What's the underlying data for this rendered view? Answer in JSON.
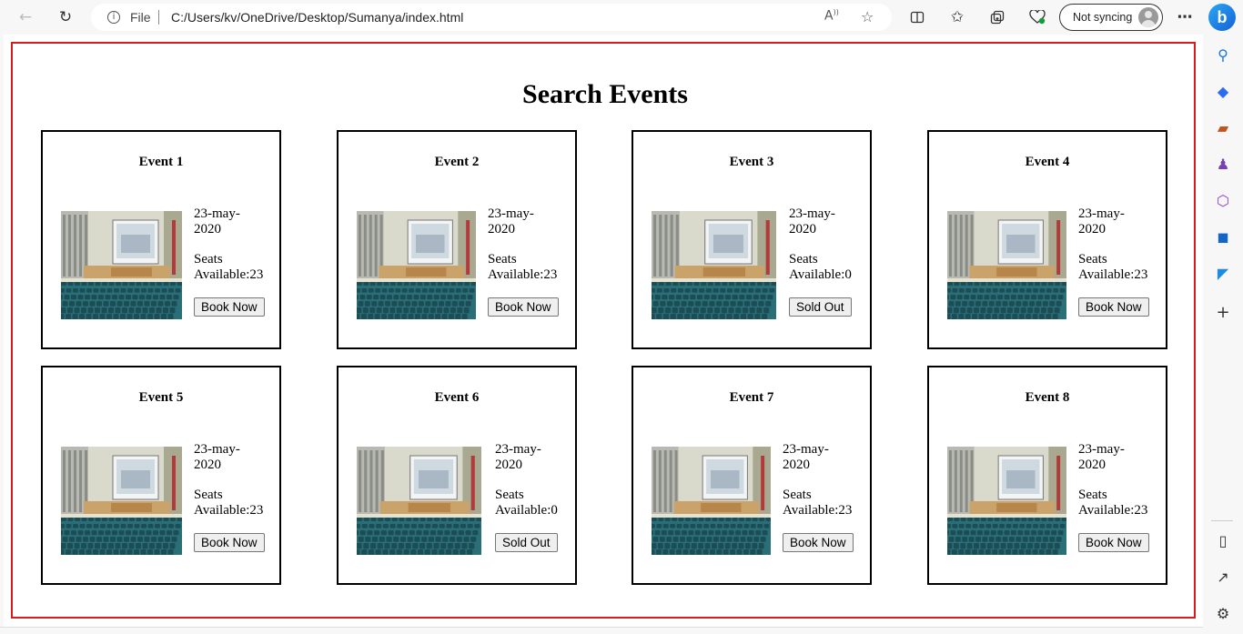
{
  "browser": {
    "file_label": "File",
    "url": "C:/Users/kv/OneDrive/Desktop/Sumanya/index.html",
    "sync_label": "Not syncing"
  },
  "page": {
    "title": "Search Events"
  },
  "events": [
    {
      "name": "Event 1",
      "date": "23-may-2020",
      "seats": "Seats Available:23",
      "button": "Book Now"
    },
    {
      "name": "Event 2",
      "date": "23-may-2020",
      "seats": "Seats Available:23",
      "button": "Book Now"
    },
    {
      "name": "Event 3",
      "date": "23-may-2020",
      "seats": "Seats Available:0",
      "button": "Sold Out"
    },
    {
      "name": "Event 4",
      "date": "23-may-2020",
      "seats": "Seats Available:23",
      "button": "Book Now"
    },
    {
      "name": "Event 5",
      "date": "23-may-2020",
      "seats": "Seats Available:23",
      "button": "Book Now"
    },
    {
      "name": "Event 6",
      "date": "23-may-2020",
      "seats": "Seats Available:0",
      "button": "Sold Out"
    },
    {
      "name": "Event 7",
      "date": "23-may-2020",
      "seats": "Seats Available:23",
      "button": "Book Now"
    },
    {
      "name": "Event 8",
      "date": "23-may-2020",
      "seats": "Seats Available:23",
      "button": "Book Now"
    }
  ],
  "colors": {
    "page_border": "#d71a1a",
    "seat_teal": "#1f5f66",
    "wall": "#d8d9cc",
    "screen": "#dfe8ee"
  },
  "icons": {
    "back": "back-arrow-icon",
    "refresh": "refresh-icon",
    "info": "info-icon",
    "read_aloud": "read-aloud-icon",
    "favorite": "star-icon",
    "split": "split-screen-icon",
    "favorites": "favorites-icon",
    "collections": "collections-icon",
    "performance": "heart-pulse-icon",
    "more": "more-dots-icon",
    "bing": "bing-copilot-icon"
  }
}
